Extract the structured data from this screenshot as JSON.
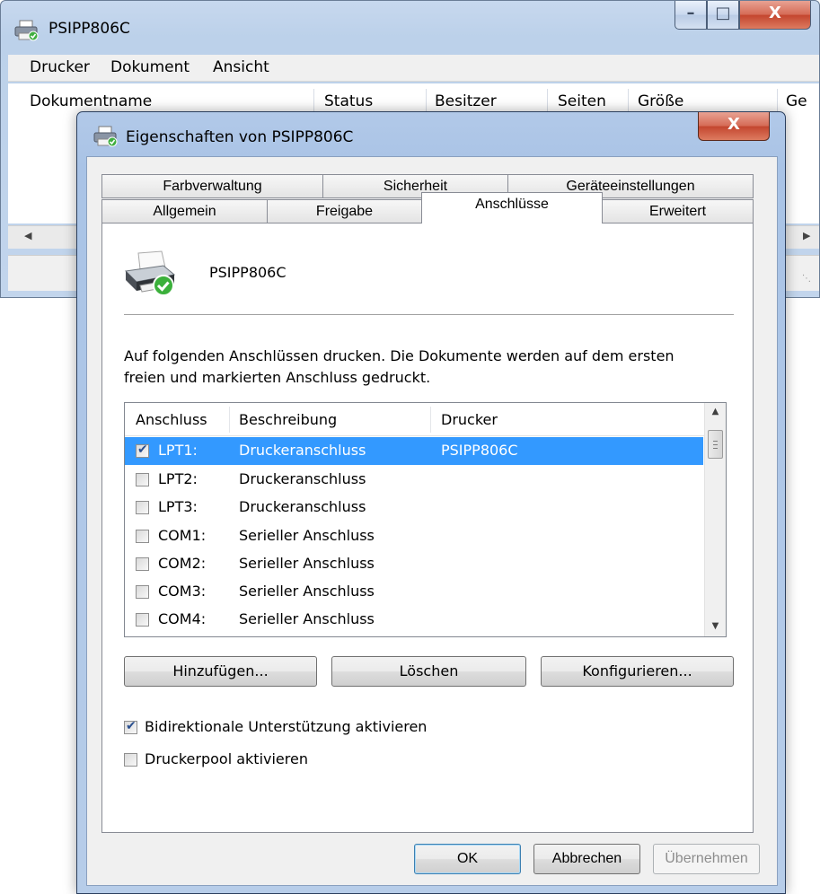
{
  "queue_window": {
    "title": "PSIPP806C",
    "menu": [
      "Drucker",
      "Dokument",
      "Ansicht"
    ],
    "columns": [
      "Dokumentname",
      "Status",
      "Besitzer",
      "Seiten",
      "Größe",
      "Ge"
    ],
    "controls": {
      "minimize": "–",
      "maximize": "□",
      "close": "X"
    }
  },
  "dialog": {
    "title": "Eigenschaften von PSIPP806C",
    "close": "X",
    "tabs_row1": [
      "Farbverwaltung",
      "Sicherheit",
      "Geräteeinstellungen"
    ],
    "tabs_row2": [
      "Allgemein",
      "Freigabe",
      "Anschlüsse",
      "Erweitert"
    ],
    "active_tab": "Anschlüsse",
    "printer_name": "PSIPP806C",
    "description": "Auf folgenden Anschlüssen drucken. Die Dokumente werden auf dem ersten",
    "description2": "freien und markierten Anschluss gedruckt.",
    "ports_table": {
      "headers": [
        "Anschluss",
        "Beschreibung",
        "Drucker"
      ],
      "rows": [
        {
          "port": "LPT1:",
          "description": "Druckeranschluss",
          "printer": "PSIPP806C",
          "checked": true,
          "selected": true
        },
        {
          "port": "LPT2:",
          "description": "Druckeranschluss",
          "printer": "",
          "checked": false,
          "selected": false
        },
        {
          "port": "LPT3:",
          "description": "Druckeranschluss",
          "printer": "",
          "checked": false,
          "selected": false
        },
        {
          "port": "COM1:",
          "description": "Serieller Anschluss",
          "printer": "",
          "checked": false,
          "selected": false
        },
        {
          "port": "COM2:",
          "description": "Serieller Anschluss",
          "printer": "",
          "checked": false,
          "selected": false
        },
        {
          "port": "COM3:",
          "description": "Serieller Anschluss",
          "printer": "",
          "checked": false,
          "selected": false
        },
        {
          "port": "COM4:",
          "description": "Serieller Anschluss",
          "printer": "",
          "checked": false,
          "selected": false
        }
      ]
    },
    "buttons": {
      "add": "Hinzufügen...",
      "delete": "Löschen",
      "configure": "Konfigurieren..."
    },
    "options": [
      {
        "label": "Bidirektionale Unterstützung aktivieren",
        "checked": true
      },
      {
        "label": "Druckerpool aktivieren",
        "checked": false
      }
    ],
    "footer_buttons": {
      "ok": "OK",
      "cancel": "Abbrechen",
      "apply": "Übernehmen"
    }
  }
}
